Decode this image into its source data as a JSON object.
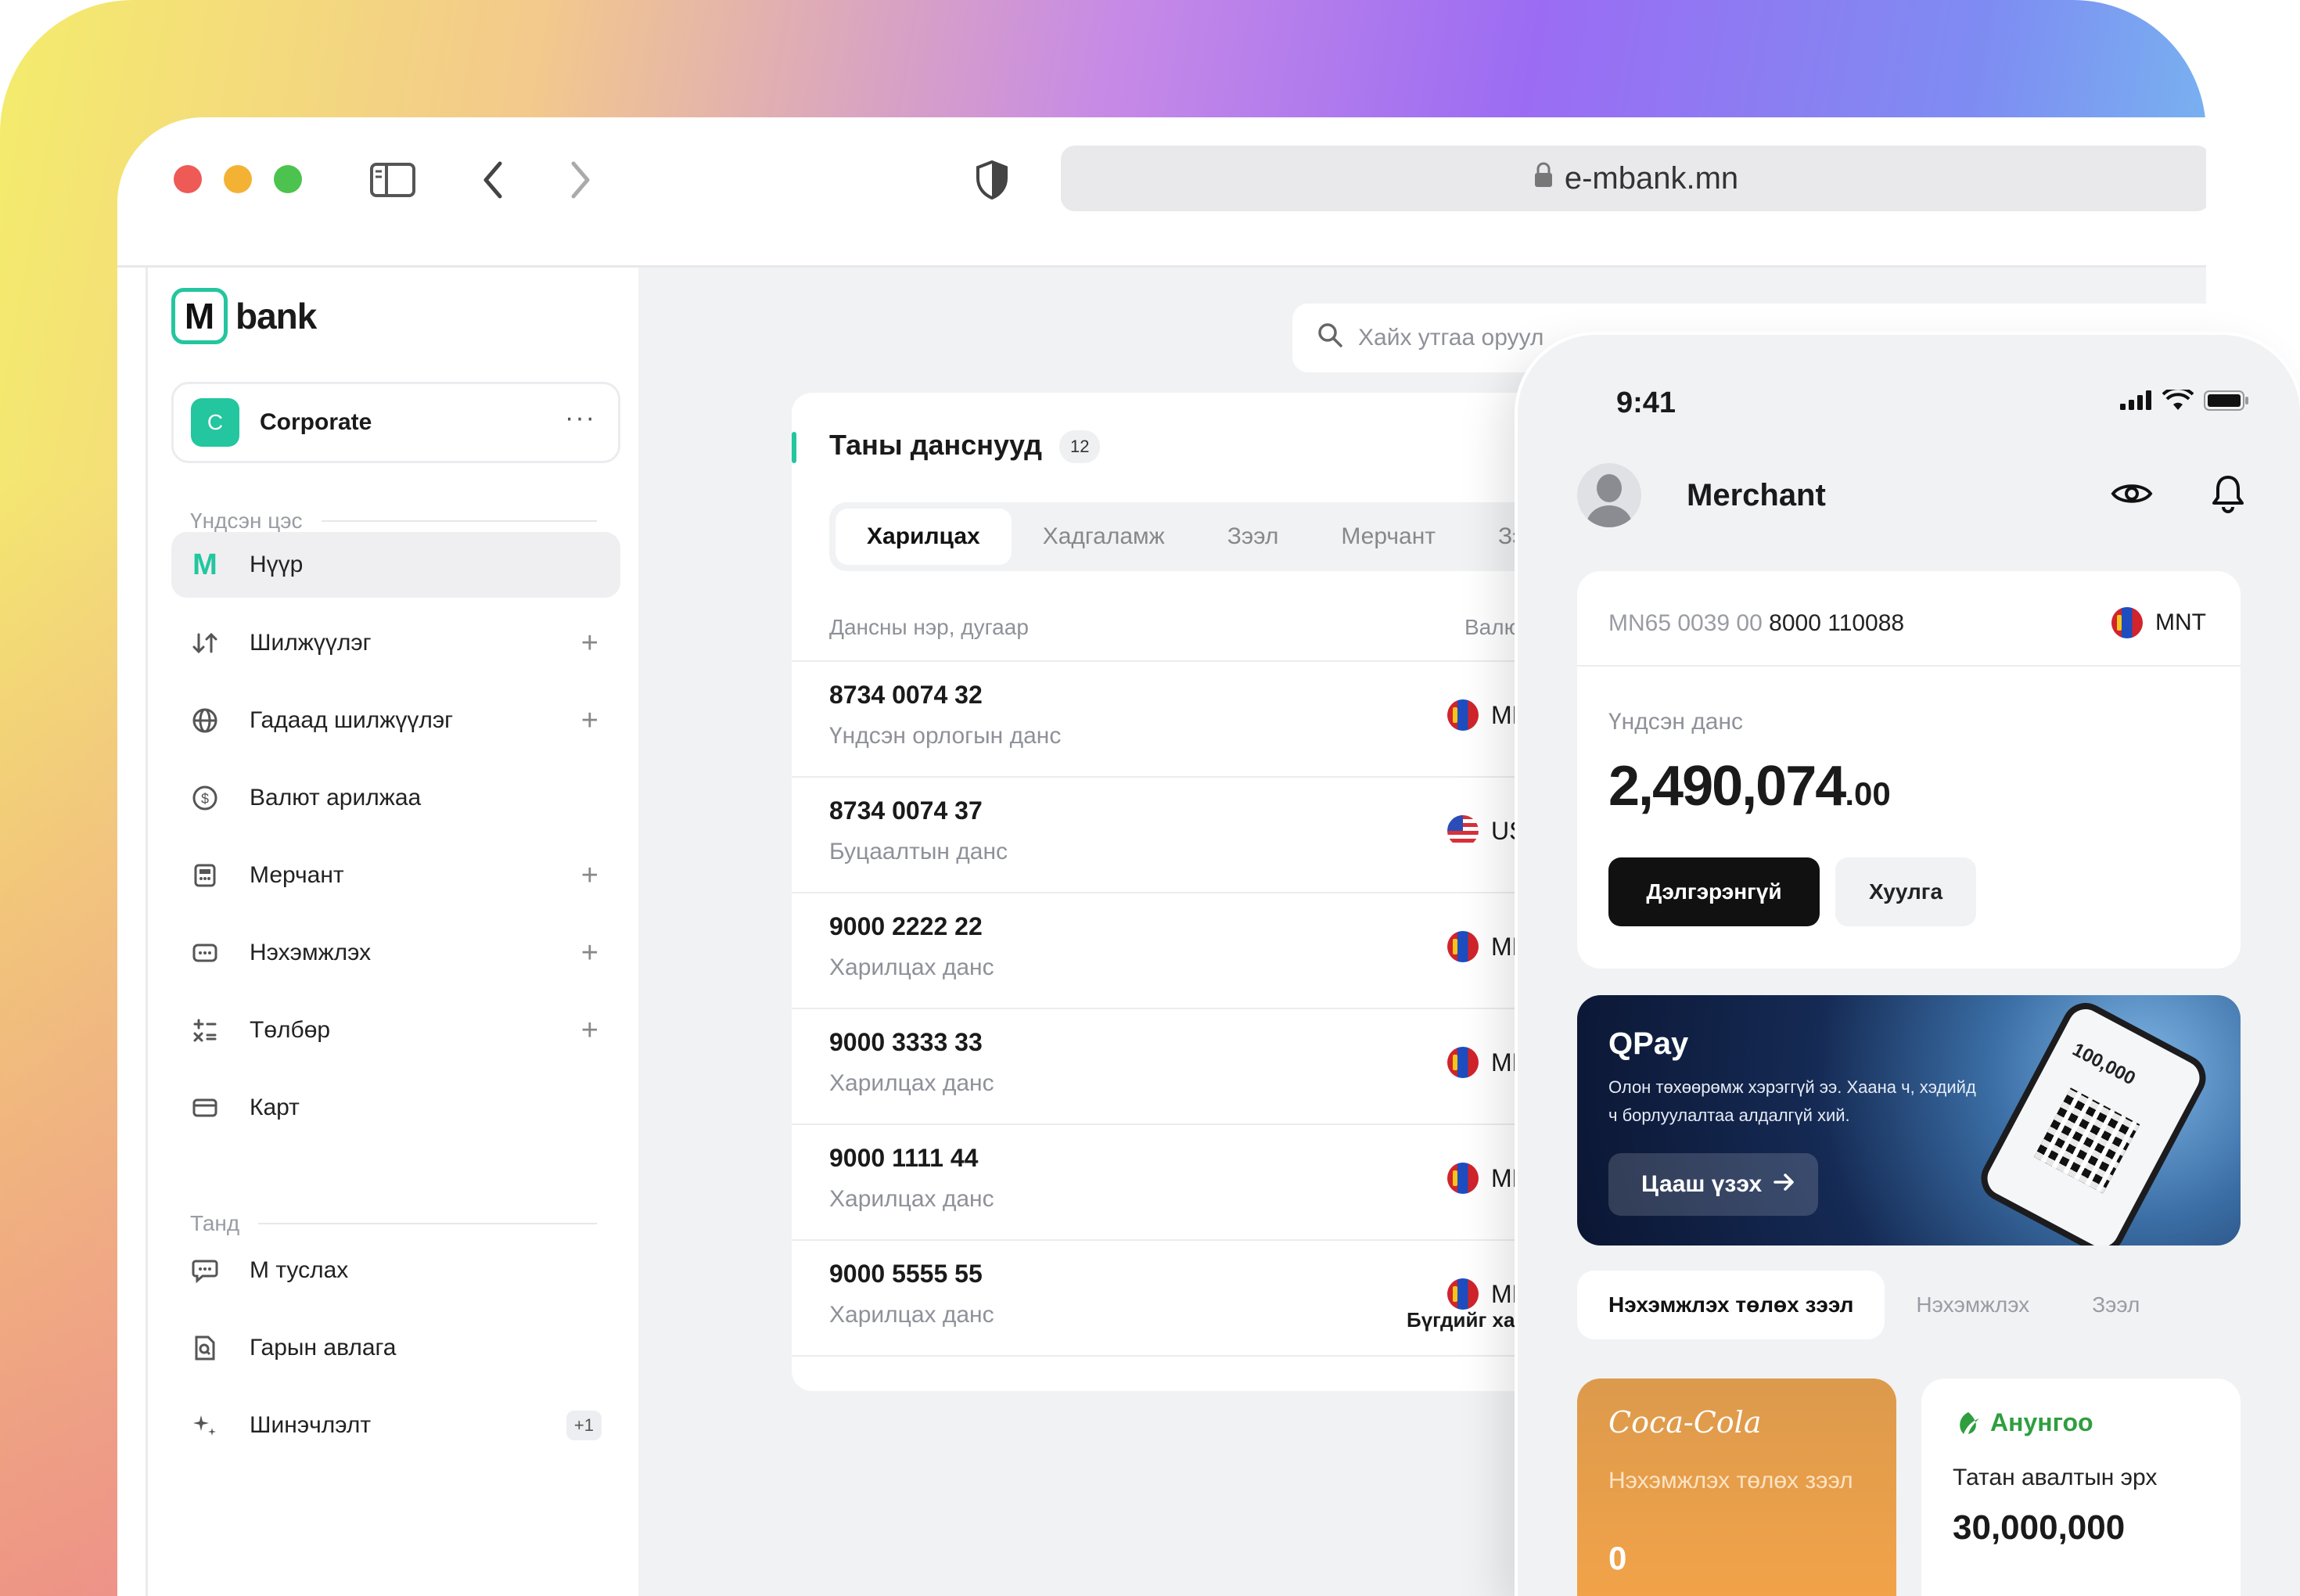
{
  "browser": {
    "url": "e-mbank.mn"
  },
  "sidebar": {
    "logo_mark": "M",
    "logo_text": "bank",
    "org_initial": "C",
    "org_name": "Corporate",
    "org_more": "···",
    "section_main": "Үндсэн цэс",
    "section_you": "Танд",
    "items": [
      {
        "label": "Нүүр",
        "icon": "home-m-icon",
        "active": true
      },
      {
        "label": "Шилжүүлэг",
        "icon": "transfer-icon",
        "plus": "+"
      },
      {
        "label": "Гадаад шилжүүлэг",
        "icon": "globe-icon",
        "plus": "+"
      },
      {
        "label": "Валют арилжаа",
        "icon": "currency-icon"
      },
      {
        "label": "Мерчант",
        "icon": "merchant-icon",
        "plus": "+"
      },
      {
        "label": "Нэхэмжлэх",
        "icon": "invoice-icon",
        "plus": "+"
      },
      {
        "label": "Төлбөр",
        "icon": "payment-icon",
        "plus": "+"
      },
      {
        "label": "Карт",
        "icon": "card-icon"
      }
    ],
    "you_items": [
      {
        "label": "М туслах",
        "icon": "chat-icon"
      },
      {
        "label": "Гарын авлага",
        "icon": "guide-icon"
      },
      {
        "label": "Шинэчлэлт",
        "icon": "sparkle-icon",
        "count": "+1"
      }
    ]
  },
  "search": {
    "placeholder": "Хайх утгаа оруул"
  },
  "accounts": {
    "title": "Таны данснууд",
    "count": "12",
    "tabs": [
      "Харилцах",
      "Хадгаламж",
      "Зээл",
      "Мерчант",
      "Зээлийн эрх"
    ],
    "col_name": "Дансны нэр, дугаар",
    "col_currency": "Валют",
    "rows": [
      {
        "number": "8734 0074 32",
        "desc": "Үндсэн орлогын данс",
        "currency": "MNT"
      },
      {
        "number": "8734 0074 37",
        "desc": "Буцаалтын данс",
        "currency": "USD"
      },
      {
        "number": "9000 2222 22",
        "desc": "Харилцах данс",
        "currency": "MNT"
      },
      {
        "number": "9000 3333 33",
        "desc": "Харилцах данс",
        "currency": "MNT"
      },
      {
        "number": "9000 1111 44",
        "desc": "Харилцах данс",
        "currency": "MNT"
      },
      {
        "number": "9000 5555 55",
        "desc": "Харилцах данс",
        "currency": "MNT"
      }
    ],
    "view_all": "Бүгдийг харах"
  },
  "phone": {
    "time": "9:41",
    "user": "Merchant",
    "iban_prefix": "MN65 0039 00",
    "iban_number": "8000 110088",
    "currency": "MNT",
    "balance_label": "Үндсэн данс",
    "balance_main": "2,490,074",
    "balance_cents": ".00",
    "btn_details": "Дэлгэрэнгүй",
    "btn_statement": "Хуулга",
    "qpay": {
      "title": "QPay",
      "desc": "Олон төхөөрөмж хэрэггүй ээ. Хаана ч, хэдийд ч борлуулалтаа алдалгүй хий.",
      "cta": "Цааш үзэх",
      "mock_amount": "100,000"
    },
    "segments": [
      "Нэхэмжлэх төлөх зээл",
      "Нэхэмжлэх",
      "Зээл"
    ],
    "tiles": {
      "coke_brand": "Coca-Cola",
      "coke_label": "Нэхэмжлэх төлөх зээл",
      "coke_value": "0",
      "anu_brand": "Анунгоо",
      "anu_label": "Татан авалтын эрх",
      "anu_value": "30,000,000"
    }
  },
  "colors": {
    "accent": "#23c69e",
    "dark_button": "#111111"
  }
}
